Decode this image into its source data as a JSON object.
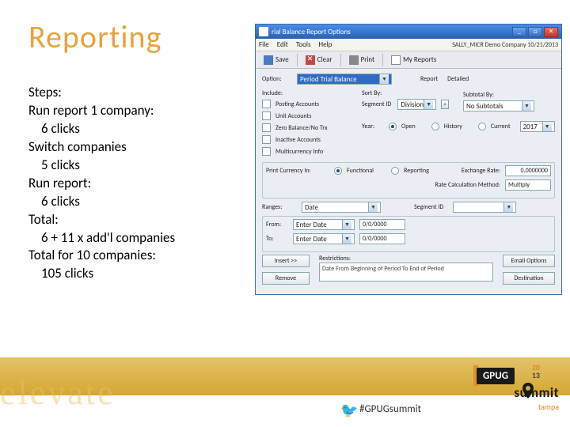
{
  "title": "Reporting",
  "steps": {
    "h": "Steps:",
    "l1": "Run report 1 company:",
    "l1a": "6 clicks",
    "l2": "Switch companies",
    "l2a": "5 clicks",
    "l3": "Run report:",
    "l3a": "6 clicks",
    "l4": "Total:",
    "l4a": "6 + 11 x add'l companies",
    "l5": "Total for 10 companies:",
    "l5a": "105 clicks"
  },
  "app": {
    "title": "rial Balance Report Options",
    "menu": {
      "file": "File",
      "edit": "Edit",
      "tools": "Tools",
      "help": "Help",
      "company": "SALLY_MICR Demo Company 10/21/2013"
    },
    "toolbar": {
      "save": "Save",
      "clear": "Clear",
      "print": "Print",
      "reports": "My Reports"
    },
    "row1": {
      "option": "Option:",
      "optval": "Period Trial Balance",
      "report": "Report",
      "reportval": "Detailed"
    },
    "include": {
      "h": "Include:",
      "posting": "Posting Accounts",
      "unit": "Unit Accounts",
      "zero": "Zero Balance/No Trx",
      "inactive": "Inactive Accounts",
      "mc": "Multicurrency Info"
    },
    "sortby": {
      "h": "Sort By:",
      "segid": "Segment ID",
      "segval": "Division"
    },
    "subtotal": {
      "h": "Subtotal By:",
      "val": "No Subtotals"
    },
    "year": {
      "h": "Year:",
      "open": "Open",
      "history": "History",
      "current": "Current",
      "val": "2017"
    },
    "curr": {
      "h": "Print Currency In:",
      "func": "Functional",
      "rep": "Reporting",
      "rate": "Exchange Rate:",
      "rateval": "0.0000000",
      "calc": "Rate Calculation Method:",
      "calcval": "Multiply"
    },
    "ranges": {
      "h": "Ranges:",
      "val": "Date",
      "segid": "Segment ID"
    },
    "fromto": {
      "from": "From:",
      "to": "To:",
      "enter": "Enter Date",
      "v1": "0/0/0000",
      "v2": "0/0/0000"
    },
    "restr": {
      "h": "Restrictions:",
      "text": "Date From Beginning of Period To End of Period"
    },
    "btns": {
      "insert": "Insert >>",
      "remove": "Remove",
      "email": "Email Options",
      "dest": "Destination"
    }
  },
  "footer": {
    "hashtag": "#GPUGsummit",
    "elevate": "elevate",
    "gpug": "GPUG",
    "y1": "20",
    "y2": "13",
    "summit": "summit",
    "tampa": "tampa"
  }
}
